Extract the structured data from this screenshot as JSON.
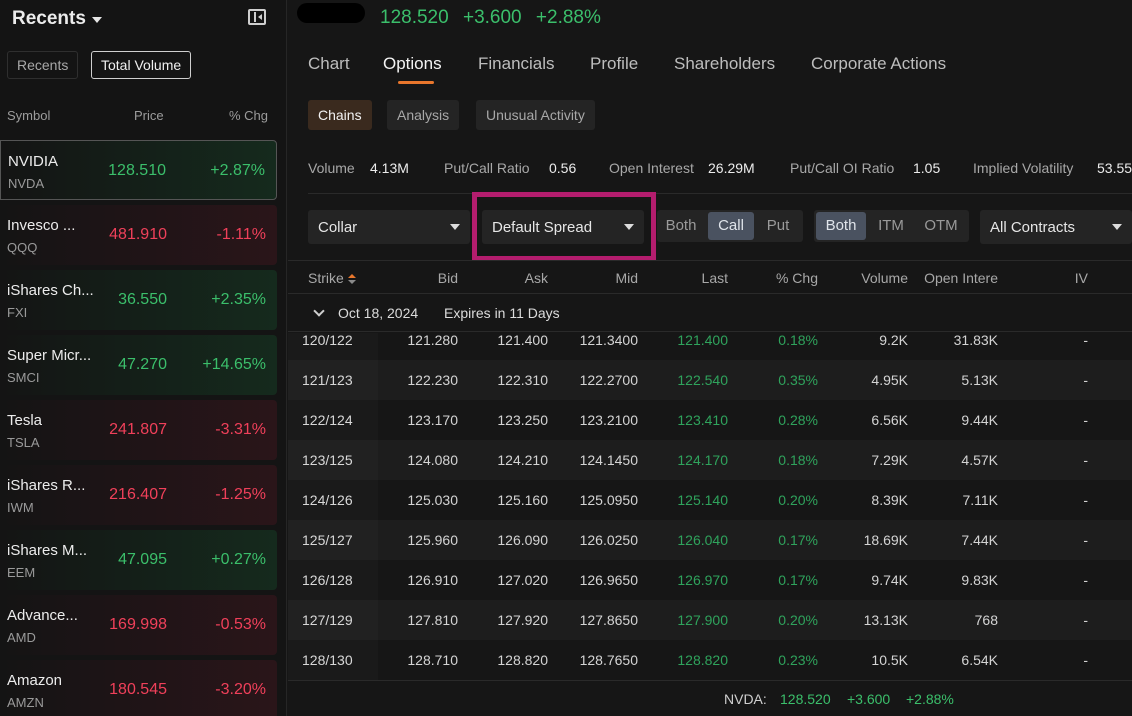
{
  "sidebar": {
    "title": "Recents",
    "tabs": [
      "Recents",
      "Total Volume"
    ],
    "columns": {
      "symbol": "Symbol",
      "price": "Price",
      "chg": "% Chg"
    },
    "items": [
      {
        "name": "NVIDIA",
        "ticker": "NVDA",
        "price": "128.510",
        "chg": "+2.87%",
        "dir": "up"
      },
      {
        "name": "Invesco ...",
        "ticker": "QQQ",
        "price": "481.910",
        "chg": "-1.11%",
        "dir": "dn"
      },
      {
        "name": "iShares Ch...",
        "ticker": "FXI",
        "price": "36.550",
        "chg": "+2.35%",
        "dir": "up"
      },
      {
        "name": "Super Micr...",
        "ticker": "SMCI",
        "price": "47.270",
        "chg": "+14.65%",
        "dir": "up"
      },
      {
        "name": "Tesla",
        "ticker": "TSLA",
        "price": "241.807",
        "chg": "-3.31%",
        "dir": "dn"
      },
      {
        "name": "iShares R...",
        "ticker": "IWM",
        "price": "216.407",
        "chg": "-1.25%",
        "dir": "dn"
      },
      {
        "name": "iShares M...",
        "ticker": "EEM",
        "price": "47.095",
        "chg": "+0.27%",
        "dir": "up"
      },
      {
        "name": "Advance...",
        "ticker": "AMD",
        "price": "169.998",
        "chg": "-0.53%",
        "dir": "dn"
      },
      {
        "name": "Amazon",
        "ticker": "AMZN",
        "price": "180.545",
        "chg": "-3.20%",
        "dir": "dn"
      }
    ]
  },
  "header": {
    "price": "128.520",
    "change": "+3.600",
    "pct": "+2.88%"
  },
  "tabs": [
    "Chart",
    "Options",
    "Financials",
    "Profile",
    "Shareholders",
    "Corporate Actions"
  ],
  "subtabs": [
    "Chains",
    "Analysis",
    "Unusual Activity"
  ],
  "stats": [
    {
      "label": "Volume",
      "value": "4.13M"
    },
    {
      "label": "Put/Call Ratio",
      "value": "0.56"
    },
    {
      "label": "Open Interest",
      "value": "26.29M"
    },
    {
      "label": "Put/Call OI Ratio",
      "value": "1.05"
    },
    {
      "label": "Implied Volatility",
      "value": "53.55"
    }
  ],
  "controls": {
    "strategy": "Collar",
    "spread": "Default Spread",
    "side": [
      "Both",
      "Call",
      "Put"
    ],
    "side_selected": "Call",
    "moneyness": [
      "Both",
      "ITM",
      "OTM"
    ],
    "moneyness_selected": "Both",
    "contracts": "All Contracts"
  },
  "table": {
    "headers": [
      "Strike",
      "Bid",
      "Ask",
      "Mid",
      "Last",
      "% Chg",
      "Volume",
      "Open Intere",
      "IV"
    ],
    "expiry_date": "Oct 18, 2024",
    "expiry_label": "Expires in 11 Days",
    "rows": [
      [
        "120/122",
        "121.280",
        "121.400",
        "121.3400",
        "121.400",
        "0.18%",
        "9.2K",
        "31.83K",
        "-"
      ],
      [
        "121/123",
        "122.230",
        "122.310",
        "122.2700",
        "122.540",
        "0.35%",
        "4.95K",
        "5.13K",
        "-"
      ],
      [
        "122/124",
        "123.170",
        "123.250",
        "123.2100",
        "123.410",
        "0.28%",
        "6.56K",
        "9.44K",
        "-"
      ],
      [
        "123/125",
        "124.080",
        "124.210",
        "124.1450",
        "124.170",
        "0.18%",
        "7.29K",
        "4.57K",
        "-"
      ],
      [
        "124/126",
        "125.030",
        "125.160",
        "125.0950",
        "125.140",
        "0.20%",
        "8.39K",
        "7.11K",
        "-"
      ],
      [
        "125/127",
        "125.960",
        "126.090",
        "126.0250",
        "126.040",
        "0.17%",
        "18.69K",
        "7.44K",
        "-"
      ],
      [
        "126/128",
        "126.910",
        "127.020",
        "126.9650",
        "126.970",
        "0.17%",
        "9.74K",
        "9.83K",
        "-"
      ],
      [
        "127/129",
        "127.810",
        "127.920",
        "127.8650",
        "127.900",
        "0.20%",
        "13.13K",
        "768",
        "-"
      ],
      [
        "128/130",
        "128.710",
        "128.820",
        "128.7650",
        "128.820",
        "0.23%",
        "10.5K",
        "6.54K",
        "-"
      ]
    ]
  },
  "footer": {
    "symbol": "NVDA:",
    "price": "128.520",
    "change": "+3.600",
    "pct": "+2.88%"
  },
  "colors": {
    "up": "#3bbf6b",
    "down": "#f0405a",
    "accent": "#e8762c",
    "highlight": "#b41d6e"
  }
}
